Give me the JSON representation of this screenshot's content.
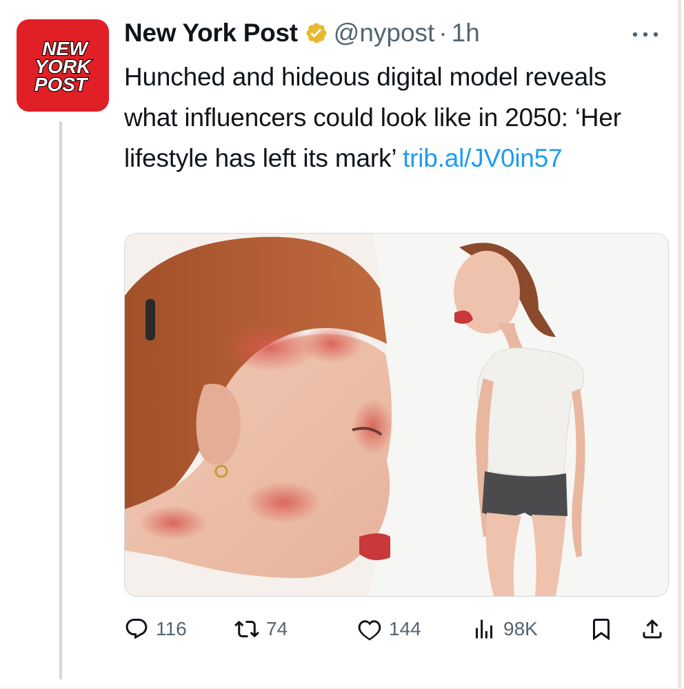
{
  "account": {
    "name": "New York Post",
    "handle": "@nypost",
    "separator": "·",
    "time": "1h",
    "avatar_lines": [
      "NEW",
      "YORK",
      "POST"
    ],
    "verified_icon": "gold-verified-badge-icon"
  },
  "more_icon": "more-horizontal-icon",
  "tweet": {
    "text": "Hunched and hideous digital model reveals what influencers could look like in 2050: ‘Her lifestyle has left its mark’ ",
    "link": "trib.al/JV0in57"
  },
  "media": {
    "left_panel": "close-up-face-profile-image",
    "right_panel": "full-body-hunched-woman-image"
  },
  "actions": {
    "reply": {
      "icon": "reply-bubble-icon",
      "count": "116"
    },
    "retweet": {
      "icon": "retweet-icon",
      "count": "74"
    },
    "like": {
      "icon": "heart-icon",
      "count": "144"
    },
    "views": {
      "icon": "views-bar-chart-icon",
      "count": "98K"
    },
    "bookmark": {
      "icon": "bookmark-icon"
    },
    "share": {
      "icon": "share-upload-icon"
    }
  },
  "colors": {
    "brand_red": "#e01f26",
    "link_blue": "#1d9bf0",
    "secondary_text": "#536471",
    "verified_gold": "#e8b930"
  }
}
